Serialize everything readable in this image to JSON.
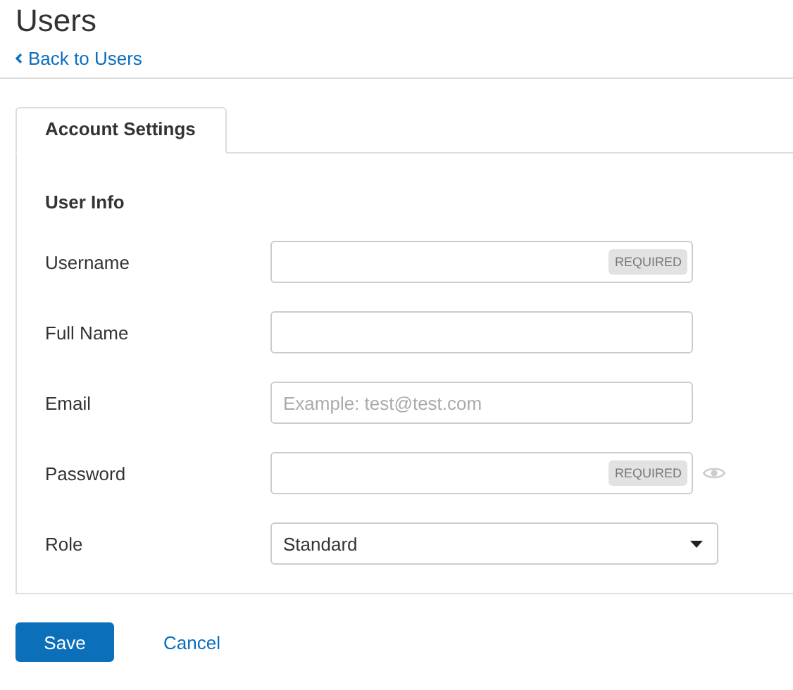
{
  "page": {
    "title": "Users",
    "back_link": "Back to Users"
  },
  "tabs": [
    {
      "label": "Account Settings",
      "selected": true
    }
  ],
  "section": {
    "title": "User Info"
  },
  "fields": [
    {
      "label": "Username",
      "kind": "text",
      "badge": "REQUIRED"
    },
    {
      "label": "Full Name",
      "kind": "text"
    },
    {
      "label": "Email",
      "kind": "text",
      "placeholder": "Example: test@test.com"
    },
    {
      "label": "Password",
      "kind": "password",
      "badge": "REQUIRED"
    },
    {
      "label": "Role",
      "kind": "select",
      "value": "Standard"
    }
  ],
  "buttons": [
    {
      "label": "Save",
      "kind": "primary"
    },
    {
      "label": "Cancel",
      "kind": "link"
    }
  ]
}
